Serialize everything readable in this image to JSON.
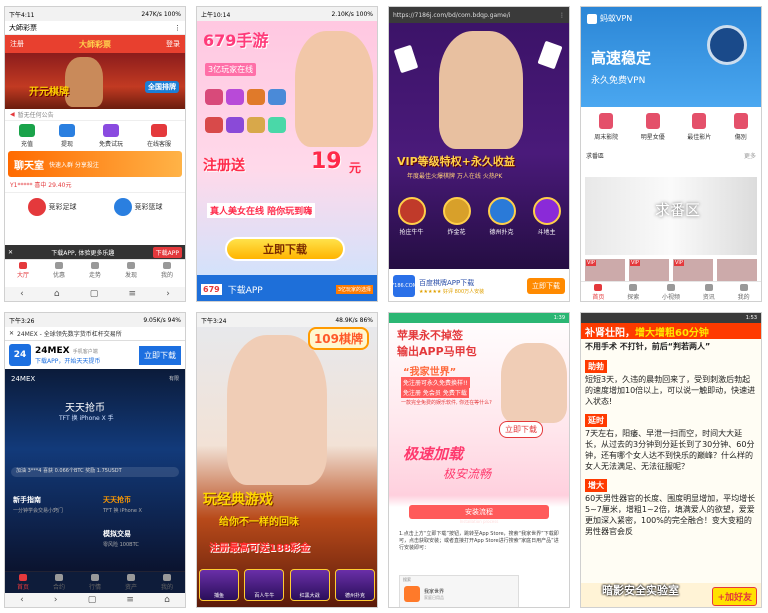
{
  "panel1": {
    "status_time": "下午4:11",
    "status_right": "247K/s  100%",
    "app_title": "大師彩票",
    "login_label": "登录",
    "register_label": "注册",
    "logo_text": "大師彩票",
    "banner_text": "开元棋牌",
    "banner_badge": "全国排牌",
    "notice": "暂无任何公告",
    "icons": [
      "充值",
      "提现",
      "免费试玩",
      "在线客服"
    ],
    "chat_title": "聊天室",
    "chat_sub": "快速入群 分享投注",
    "win_text": "Y1***** 喜中 29.40元",
    "ball1": "竞彩足球",
    "ball2": "竞彩篮球",
    "download_bar": "下载APP, 体验更多乐趣",
    "download_btn": "下载APP",
    "tabs": [
      "大厅",
      "优惠",
      "走势",
      "发现",
      "我的"
    ]
  },
  "panel2": {
    "status_time": "上午10:14",
    "status_right": "2.10K/s  100%",
    "brand": "679手游",
    "slogan": "3亿玩家在线",
    "register": "注册送",
    "register_num": "19",
    "register_unit": "元",
    "tagline": "真人美女在线 陪你玩到嗨",
    "download_btn": "立即下载",
    "bottom_logo": "679",
    "bottom_text": "下载APP",
    "bottom_sub": "3亿玩家的选择"
  },
  "panel3": {
    "url": "https://7186j.com/bd/com.bdqp.game/i",
    "vip": "VIP等级特权+永久收益",
    "vip_sub": "年度最佳火爆棋牌 万人在线 火热PK",
    "games": [
      "抢庄牛牛",
      "炸金花",
      "德州扑克",
      "斗地主"
    ],
    "ad_logo": "7186.COM",
    "ad_title": "百度棋牌APP下载",
    "ad_sub": "★★★★★ 好评  800万人安装",
    "ad_btn": "立即下载"
  },
  "panel4": {
    "app_name": "蚂蚁VPN",
    "h1": "高速稳定",
    "h2": "永久免费VPN",
    "cats": [
      "周末影院",
      "明星女優",
      "最佳影片",
      "傷別"
    ],
    "section": "求番區",
    "more": "更多",
    "big_title": "求番区",
    "thumbs": [
      "VIP",
      "VIP",
      "VIP"
    ],
    "tabs": [
      "首页",
      "探索",
      "小视频",
      "资讯",
      "我的"
    ]
  },
  "panel5": {
    "status_time": "下午3:26",
    "status_right": "9.05K/s  94%",
    "page_title": "24MEX - 全球领先数字货币杠杆交易所",
    "ad_logo": "24",
    "ad_name": "24MEX",
    "ad_name_sub": "手机客户端",
    "ad_sub": "下载APP，开始天天提币",
    "ad_btn": "立即下载",
    "brand": "24MEX",
    "rate": "有限",
    "h1": "天天抢币",
    "h2": "TFT 换 iPhone X 手",
    "ticker": "加油 3***4 喜获 0.066个BTC 奖励 1.75USDT",
    "g1": "新手指南",
    "g1s": "一分钟学会交易小窍门",
    "g2": "天天抢币",
    "g2s": "TFT 换 iPhone X",
    "g3": "模拟交易",
    "g3s": "零风险 100BTC",
    "tabs": [
      "首页",
      "合约",
      "行情",
      "资产",
      "我的"
    ]
  },
  "panel6": {
    "status_time": "下午3:24",
    "status_right": "48.9K/s  86%",
    "logo": "109棋牌",
    "t1": "玩经典游戏",
    "t2": "给你不一样的回味",
    "t3": "注册最高可送188彩金",
    "games": [
      "捕鱼",
      "百人牛牛",
      "红黑大战",
      "德州扑克"
    ]
  },
  "panel7": {
    "status_right": "1:39",
    "h1": "苹果永不掉签",
    "h2": "输出APP马甲包",
    "h3": "“我家世界”",
    "h4": "免注册可永久免费换样!!",
    "h5": "免注册 免会员 免费下载",
    "h6": "一款完全免费的娱乐软件, 你还在等什么?",
    "open_btn": "立即下载",
    "hw1": "极速加载",
    "hw2": "极安流畅",
    "inst": "安装流程",
    "inst_sub": "Installation process",
    "steps": "1.点击上方“立即下载”按钮，跳转至App Store，搜索“我家世界”下载即可，点击获取安装；或者直接打开App Store进行搜索“家庭日用产品”进行安装即可：",
    "mini_title": "搜索",
    "mini_name": "我家世界",
    "mini_sub": "家庭日用品"
  },
  "panel8": {
    "status_right": "1:53",
    "title_a": "补肾壮阳，",
    "title_b": "增大增粗60分钟",
    "sub": "不用手术  不打针，前后“判若两人”",
    "sec1": "助勃",
    "txt1": "短短3天，久违的晨勃回来了，受到刺激后勃起的速度增加10倍以上，可以说一触即动，快速进入状态!",
    "sec2": "延时",
    "txt2": "7天左右，阳痿、早泄一扫而空，时间大大延长，从过去的3分钟到分延长到了30分钟、60分钟，还有哪个女人达不到快乐的巅峰？什么样的女人无法满足、无法征服呢？",
    "sec3": "增大",
    "txt3": "60天男性器官的长度、围度明显增加，平均增长5~7厘米，增粗1~2倍，填满爱人的欲望，爱爱更加深入紧密，100%的完全融合！变大变粗的男性器官会反",
    "bottom_btn": "+加好友"
  },
  "watermark": "暗影安全实验室"
}
